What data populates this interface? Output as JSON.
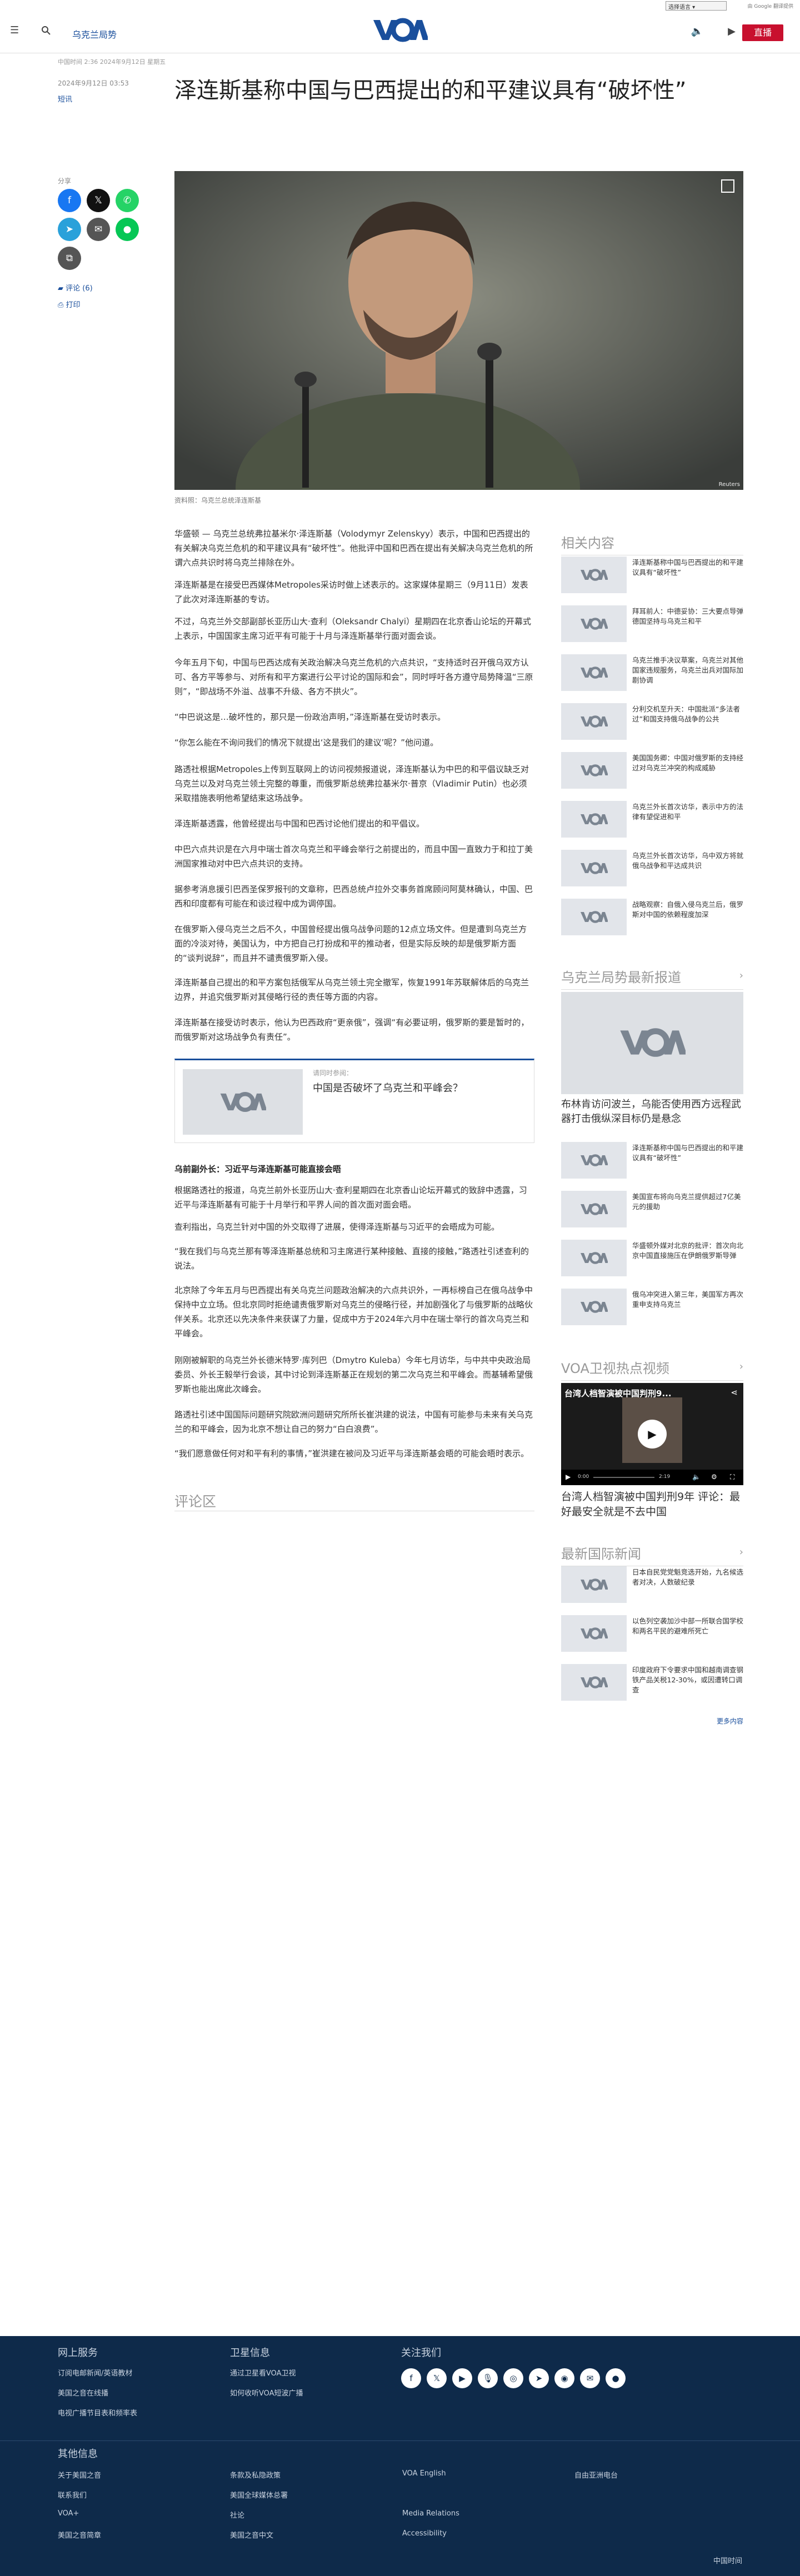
{
  "topbar": {
    "language_select": "选择语言",
    "google_label": "由 Google 翻译提供"
  },
  "header": {
    "section": "乌克兰局势",
    "live_label": "直播",
    "logo_text": "VOA"
  },
  "article": {
    "dateline": "中国时间 2:36 2024年9月12日 星期五",
    "pub_date": "2024年9月12日 03:53",
    "category": "短讯",
    "title": "泽连斯基称中国与巴西提出的和平建议具有“破坏性”",
    "caption": "资料照：乌克兰总统泽连斯基",
    "hero_credit": "Reuters",
    "paragraphs": [
      "华盛顿 — 乌克兰总统弗拉基米尔·泽连斯基（Volodymyr Zelenskyy）表示，中国和巴西提出的有关解决乌克兰危机的和平建议具有“破坏性”。他批评中国和巴西在提出有关解决乌克兰危机的所谓六点共识时将乌克兰排除在外。",
      "泽连斯基是在接受巴西媒体Metropoles采访时做上述表示的。这家媒体星期三（9月11日）发表了此次对泽连斯基的专访。",
      "不过，乌克兰外交部副部长亚历山大·查利（Oleksandr Chalyi）星期四在北京香山论坛的开幕式上表示，中国国家主席习近平有可能于十月与泽连斯基举行面对面会谈。",
      "今年五月下旬，中国与巴西达成有关政治解决乌克兰危机的六点共识，“支持适时召开俄乌双方认可、各方平等参与、对所有和平方案进行公平讨论的国际和会”，同时呼吁各方遵守局势降温“三原则”，“即战场不外溢、战事不升级、各方不拱火”。",
      "“中巴说这是…破坏性的，那只是一份政治声明，”泽连斯基在受访时表示。",
      "“你怎么能在不询问我们的情况下就提出‘这是我们的建议’呢？”他问道。",
      "路透社根据Metropoles上传到互联网上的访问视频报道说，泽连斯基认为中巴的和平倡议缺乏对乌克兰以及对乌克兰领土完整的尊重，而俄罗斯总统弗拉基米尔·普京（Vladimir Putin）也必须采取措施表明他希望结束这场战争。",
      "泽连斯基透露，他曾经提出与中国和巴西讨论他们提出的和平倡议。",
      "中巴六点共识是在六月中瑞士首次乌克兰和平峰会举行之前提出的，而且中国一直致力于和拉丁美洲国家推动对中巴六点共识的支持。",
      "据参考消息援引巴西圣保罗报刊的文章称，巴西总统卢拉外交事务首席顾问阿莫林确认，中国、巴西和印度都有可能在和谈过程中成为调停国。",
      "在俄罗斯入侵乌克兰之后不久，中国曾经提出俄乌战争问题的12点立场文件。但是遭到乌克兰方面的冷淡对待，美国认为，中方把自己打扮成和平的推动者，但是实际反映的却是俄罗斯方面的“谈判说辞”，而且并不谴责俄罗斯入侵。",
      "泽连斯基自己提出的和平方案包括俄军从乌克兰领土完全撤军，恢复1991年苏联解体后的乌克兰边界，并追究俄罗斯对其侵略行径的责任等方面的内容。",
      "泽连斯基在接受访时表示，他认为巴西政府“更亲俄”，强调“有必要证明，俄罗斯的要是暂时的，而俄罗斯对这场战争负有责任”。",
      "乌前副外长：习近平与泽连斯基可能直接会晤",
      "根据路透社的报道，乌克兰前外长亚历山大·查利星期四在北京香山论坛开幕式的致辞中透露，习近平与泽连斯基有可能于十月举行和平界人间的首次面对面会晤。",
      "查利指出，乌克兰针对中国的外交取得了进展，使得泽连斯基与习近平的会晤成为可能。",
      "“我在我们与乌克兰那有等泽连斯基总统和习主席进行某种接触、直接的接触，”路透社引述查利的说法。",
      "北京除了今年五月与巴西提出有关乌克兰问题政治解决的六点共识外，一再标榜自己在俄乌战争中保持中立立场。但北京同时拒绝谴责俄罗斯对乌克兰的侵略行径，并加剧强化了与俄罗斯的战略伙伴关系。北京还以先决条件来获谋了力量，促成中方于2024年六月中在瑞士举行的首次乌克兰和平峰会。",
      "刚刚被解职的乌克兰外长德米特罗·库列巴（Dmytro Kuleba）今年七月访华，与中共中央政治局委员、外长王毅举行会谈，其中讨论到泽连斯基正在规划的第二次乌克兰和平峰会。而基辅希望俄罗斯也能出席此次峰会。",
      "路透社引述中国国际问题研究院欧洲问题研究所所长崔洪建的说法，中国有可能参与未来有关乌克兰的和平峰会，因为北京不想让自己的努力“白白浪费”。",
      "“我们愿意做任何对和平有利的事情，”崔洪建在被问及习近平与泽连斯基会晤的可能会晤时表示。"
    ],
    "related": {
      "label": "请同时参阅：",
      "title": "中国是否破坏了乌克兰和平峰会？"
    },
    "comments_heading": "评论区"
  },
  "share": {
    "label": "分享",
    "comments": "评论 (6)",
    "print": "打印"
  },
  "rail": {
    "related_heading": "相关内容",
    "related_items": [
      "泽连斯基称中国与巴西提出的和平建议具有“破坏性”",
      "拜耳前人：中德妥协：三大要点导弹德国坚持与乌克兰和平",
      "乌克兰推手决议草案，乌克兰对其他国家违规服务，乌克兰出兵对国际加剧协调",
      "分利交机至升天：中国批派“多法者过”和国支持俄乌战争的公共",
      "美国国务卿：中国对俄罗斯的支持经过对乌克兰冲突的构成威胁",
      "乌克兰外长首次访华，表示中方的法律有望促进和平",
      "乌克兰外长首次访华，乌中双方将就俄乌战争和平达成共识",
      "战略观察：自俄入侵乌克兰后，俄罗斯对中国的依赖程度加深"
    ],
    "latest_heading": "乌克兰局势最新报道",
    "latest_big_title": "布林肯访问波兰，乌能否使用西方远程武器打击俄纵深目标仍是悬念",
    "latest_items": [
      "泽连斯基称中国与巴西提出的和平建议具有“破坏性”",
      "美国宣布将向乌克兰提供超过7亿美元的援助",
      "华盛顿外媒对北京的批评：首次向北京中国直接施压在伊朗俄罗斯导弹",
      "俄乌冲突进入第三年，美国军方再次重申支持乌克兰"
    ],
    "video_heading": "VOA卫视热点视频",
    "video_overlay": "台湾人档智演被中国判刑9...",
    "video_time": "2:19",
    "video_current": "0:00",
    "video_title": "台湾人档智演被中国判刑9年 评论：最好最安全就是不去中国",
    "intl_heading": "最新国际新闻",
    "intl_items": [
      "日本自民党党魁竞选开始，九名候选者对决，人数破纪录",
      "以色列空袭加沙中部一所联合国学校和两名平民的避难所死亡",
      "印度政府下令要求中国和越南调查钢铁产品关税12-30%，或因遭转口调查"
    ],
    "more": "更多内容"
  },
  "footer": {
    "col1_heading": "网上服务",
    "col1": [
      "订阅电邮新闻/英语教材",
      "美国之音在线播",
      "电视广播节目表和频率表"
    ],
    "col2_heading": "卫星信息",
    "col2": [
      "通过卫星看VOA卫视",
      "如何收听VOA短波广播"
    ],
    "col3_heading": "关注我们",
    "social_icons": [
      "facebook-icon",
      "x-icon",
      "youtube-icon",
      "podcast-icon",
      "instagram-icon",
      "telegram-icon",
      "rss-icon",
      "email-icon",
      "line-icon"
    ],
    "about_heading": "其他信息",
    "about_links": [
      [
        "关于美国之音",
        "联系我们",
        "VOA+",
        "美国之音简章"
      ],
      [
        "条款及私隐政策",
        "美国全球媒体总署",
        "社论",
        "美国之音中文"
      ],
      [
        "VOA English",
        "",
        "Media Relations",
        "Accessibility"
      ],
      [
        "自由亚洲电台",
        "",
        "",
        ""
      ]
    ],
    "region": "中国时间"
  },
  "colors": {
    "brand_blue": "#1a4f9c",
    "live_red": "#c8102e",
    "footer_navy": "#0e2a4a"
  }
}
